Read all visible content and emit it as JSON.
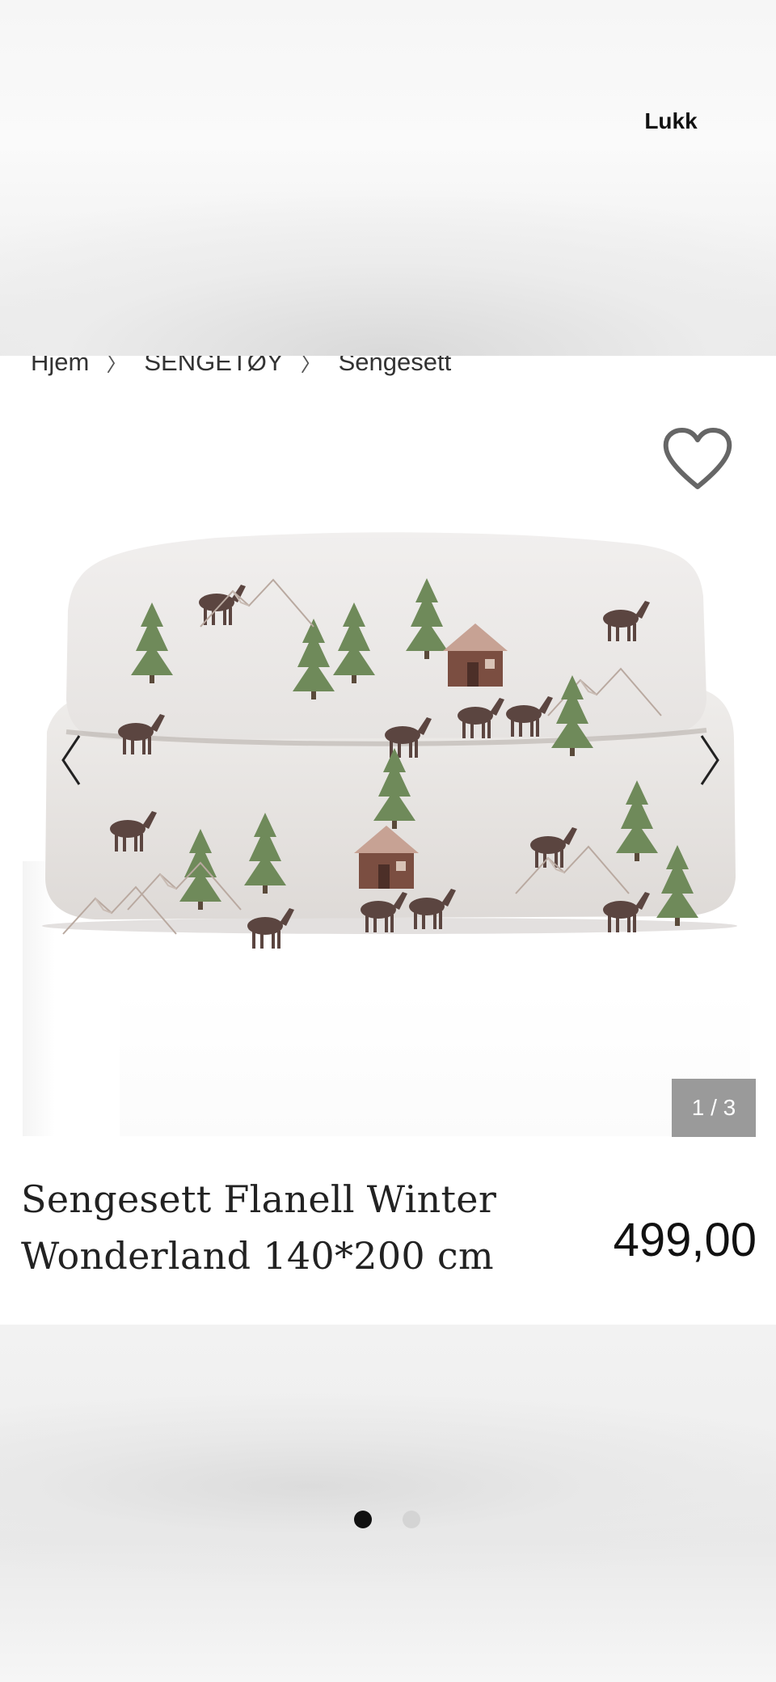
{
  "overlay": {
    "close_label": "Lukk"
  },
  "breadcrumb": {
    "items": [
      "Hjem",
      "SENGETØY",
      "Sengesett"
    ],
    "separator": "〉"
  },
  "gallery": {
    "counter": "1 / 3",
    "favorite_icon": "heart-outline-icon",
    "prev_icon": "chevron-left-icon",
    "next_icon": "chevron-right-icon"
  },
  "product": {
    "title_line1": "Sengesett Flanell Winter",
    "title_line2": "Wonderland 140*200 cm",
    "price": "499,00"
  },
  "pagination": {
    "total": 2,
    "active": 1
  },
  "colors": {
    "counter_bg": "#9a9a9a",
    "dot_active": "#111111",
    "dot_inactive": "#d4d4d4"
  }
}
